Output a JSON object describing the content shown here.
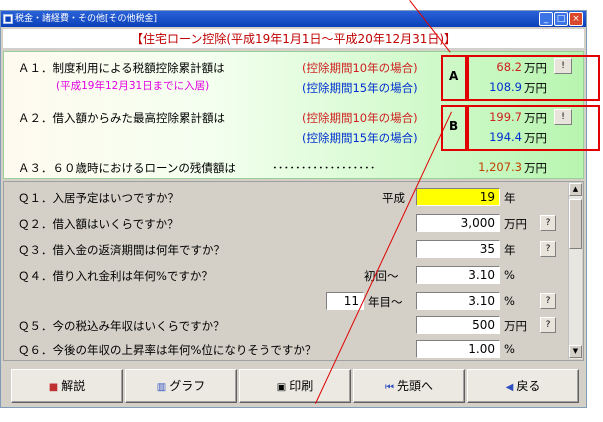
{
  "window": {
    "title": "税金・諸経費・その他[その他税金]",
    "controls": [
      "_",
      "□",
      "×"
    ]
  },
  "page_title": "【住宅ローン控除(平成19年1月1日～平成20年12月31日)】",
  "results": {
    "a1": {
      "label": "Ａ１．制度利用による税額控除累計額は",
      "note": "(平成19年12月31日までに入居)",
      "case10": "(控除期間10年の場合)",
      "case15": "(控除期間15年の場合)",
      "value10": "68.2",
      "value15": "108.9",
      "unit": "万円"
    },
    "a2": {
      "label": "Ａ２．借入額からみた最高控除累計額は",
      "case10": "(控除期間10年の場合)",
      "case15": "(控除期間15年の場合)",
      "value10": "199.7",
      "value15": "194.4",
      "unit": "万円"
    },
    "a3": {
      "label": "Ａ３．６０歳時におけるローンの残債額は",
      "dots": "･･････････････････",
      "value": "1,207.3",
      "unit": "万円"
    },
    "box_a": "A",
    "box_b": "B",
    "help": "!"
  },
  "questions": {
    "q1": {
      "label": "Ｑ１．入居予定はいつですか？",
      "prefix": "平成",
      "value": "19",
      "unit": "年"
    },
    "q2": {
      "label": "Ｑ２．借入額はいくらですか？",
      "value": "3,000",
      "unit": "万円"
    },
    "q3": {
      "label": "Ｑ３．借入金の返済期間は何年ですか？",
      "value": "35",
      "unit": "年"
    },
    "q4": {
      "label": "Ｑ４．借り入れ金利は年何%ですか？",
      "prefix": "初回～",
      "value": "3.10",
      "unit": "%",
      "year_value": "11",
      "year_suffix": "年目～",
      "value2": "3.10",
      "unit2": "%"
    },
    "q5": {
      "label": "Ｑ５．今の税込み年収はいくらですか？",
      "value": "500",
      "unit": "万円"
    },
    "q6": {
      "label": "Ｑ６．今後の年収の上昇率は年何%位になりそうですか？",
      "value": "1.00",
      "unit": "%"
    },
    "help": "?"
  },
  "footer": {
    "explain": "解説",
    "graph": "グラフ",
    "print": "印刷",
    "top": "先頭へ",
    "back": "戻る"
  },
  "colors": {
    "red_annotation": "#e00000",
    "highlight_input": "#ffff00",
    "title_red": "#c00000"
  }
}
